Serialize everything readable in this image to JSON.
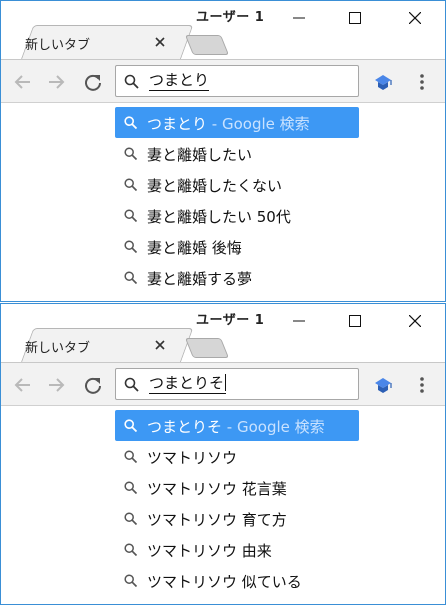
{
  "windows": [
    {
      "user_label": "ユーザー 1",
      "tab_title": "新しいタブ",
      "omnibox": {
        "query": "つまとり"
      },
      "suggestions": [
        {
          "text": "つまとり",
          "suffix": " - Google 検索",
          "selected": true
        },
        {
          "text": "妻と離婚したい",
          "suffix": "",
          "selected": false
        },
        {
          "text": "妻と離婚したくない",
          "suffix": "",
          "selected": false
        },
        {
          "text": "妻と離婚したい 50代",
          "suffix": "",
          "selected": false
        },
        {
          "text": "妻と離婚 後悔",
          "suffix": "",
          "selected": false
        },
        {
          "text": "妻と離婚する夢",
          "suffix": "",
          "selected": false
        }
      ]
    },
    {
      "user_label": "ユーザー 1",
      "tab_title": "新しいタブ",
      "omnibox": {
        "query": "つまとりそ"
      },
      "suggestions": [
        {
          "text": "つまとりそ",
          "suffix": " - Google 検索",
          "selected": true
        },
        {
          "text": "ツマトリソウ",
          "suffix": "",
          "selected": false
        },
        {
          "text": "ツマトリソウ 花言葉",
          "suffix": "",
          "selected": false
        },
        {
          "text": "ツマトリソウ 育て方",
          "suffix": "",
          "selected": false
        },
        {
          "text": "ツマトリソウ 由来",
          "suffix": "",
          "selected": false
        },
        {
          "text": "ツマトリソウ 似ている",
          "suffix": "",
          "selected": false
        }
      ]
    }
  ],
  "icons": {
    "back": "arrow-left-icon",
    "forward": "arrow-right-icon",
    "reload": "reload-icon",
    "search": "search-icon",
    "extension": "extension-icon",
    "menu": "kebab-menu-icon",
    "minimize": "minimize-icon",
    "maximize": "maximize-icon",
    "close": "close-icon"
  },
  "colors": {
    "selected_bg": "#3d98f4",
    "window_border": "#3a8fd6",
    "toolbar_bg": "#f2f2f2"
  }
}
